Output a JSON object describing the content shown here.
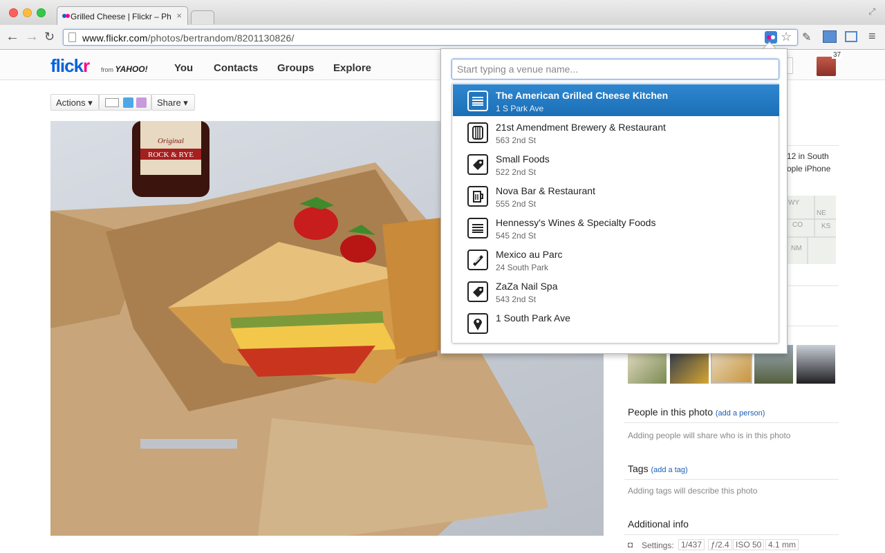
{
  "browser": {
    "tab_title": "Grilled Cheese | Flickr – Ph",
    "tab_close": "×",
    "url_host": "www.flickr.com",
    "url_path": "/photos/bertrandom/8201130826/"
  },
  "flickr": {
    "logo_main": "flickr",
    "logo_from": "from",
    "logo_yahoo": "YAHOO!",
    "nav": [
      "You",
      "Contacts",
      "Groups",
      "Explore"
    ],
    "notification_count": "37"
  },
  "photo_actions": {
    "actions_label": "Actions ▾",
    "share_label": "Share ▾"
  },
  "photo": {
    "bottle_brand": "Original",
    "bottle_name": "ROCK & RYE"
  },
  "sidebar": {
    "taken_partial_1": "12 in South",
    "taken_partial_2": "ople iPhone",
    "map_labels": [
      "WY",
      "NE",
      "CO",
      "KS",
      "NM"
    ],
    "people_title": "People in this photo",
    "people_add": "(add a person)",
    "people_note": "Adding people will share who is in this photo",
    "tags_title": "Tags",
    "tags_add": "(add a tag)",
    "tags_note": "Adding tags will describe this photo",
    "additional_title": "Additional info",
    "settings_label": "Settings:",
    "settings_values": [
      "1/437",
      "ƒ/2.4",
      "ISO 50",
      "4.1 mm"
    ]
  },
  "venue_search": {
    "placeholder": "Start typing a venue name...",
    "selected_index": 0,
    "results": [
      {
        "name": "The American Grilled Cheese Kitchen",
        "address": "1 S Park Ave",
        "icon": "food-icon"
      },
      {
        "name": "21st Amendment Brewery & Restaurant",
        "address": "563 2nd St",
        "icon": "barrel-icon"
      },
      {
        "name": "Small Foods",
        "address": "522 2nd St",
        "icon": "tag-icon"
      },
      {
        "name": "Nova Bar & Restaurant",
        "address": "555 2nd St",
        "icon": "beer-mug-icon"
      },
      {
        "name": "Hennessy's Wines & Specialty Foods",
        "address": "545 2nd St",
        "icon": "food-icon"
      },
      {
        "name": "Mexico au Parc",
        "address": "24 South Park",
        "icon": "burrito-icon"
      },
      {
        "name": "ZaZa Nail Spa",
        "address": "543 2nd St",
        "icon": "tag-icon"
      },
      {
        "name": "1 South Park Ave",
        "address": "",
        "icon": "map-pin-icon"
      }
    ]
  },
  "colors": {
    "flickr_blue": "#0063dc",
    "flickr_pink": "#ff0084",
    "selection_blue": "#1b6fb6"
  }
}
